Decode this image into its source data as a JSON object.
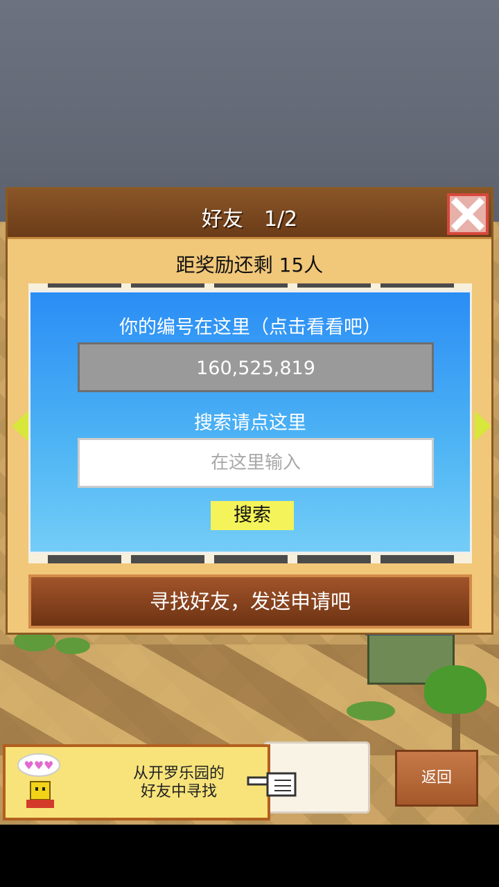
{
  "dialog": {
    "title": "好友　1/2",
    "reward_text": "距奖励还剩 15人",
    "panel": {
      "id_label": "你的编号在这里（点击看看吧）",
      "id_value": "160,525,819",
      "search_label": "搜索请点这里",
      "search_placeholder": "在这里输入",
      "search_button": "搜索"
    },
    "find_friends_button": "寻找好友，发送申请吧"
  },
  "bottom": {
    "cairo_friends_line1": "从开罗乐园的",
    "cairo_friends_line2": "好友中寻找",
    "back_button": "返回"
  },
  "colors": {
    "panel_gradient_top": "#2a8df5",
    "close_border": "#d7483c",
    "search_button_bg": "#f4f35a",
    "header_brown": "#7a4620"
  },
  "icons": {
    "close": "close-icon",
    "prev": "arrow-left-icon",
    "next": "arrow-right-icon",
    "hand": "pointing-hand-icon",
    "avatar": "cairo-character-icon"
  }
}
